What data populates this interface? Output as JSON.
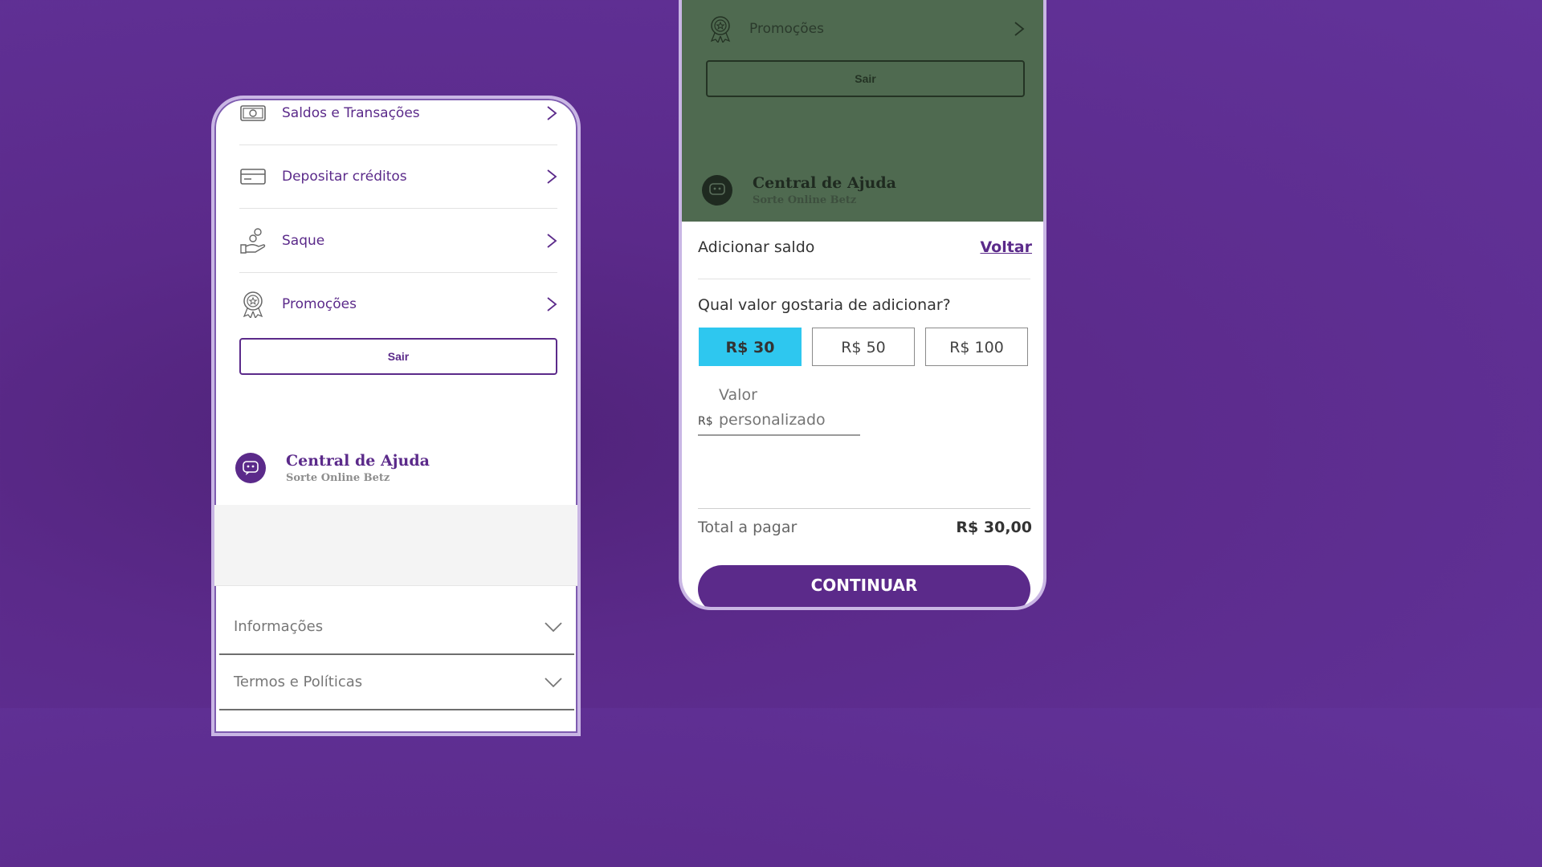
{
  "left_phone": {
    "menu": [
      {
        "label": "Saldos e Transações",
        "icon": "money-icon"
      },
      {
        "label": "Depositar créditos",
        "icon": "credit-card-icon"
      },
      {
        "label": "Saque",
        "icon": "hand-coins-icon"
      },
      {
        "label": "Promoções",
        "icon": "award-icon"
      }
    ],
    "logout_label": "Sair",
    "help": {
      "title": "Central de Ajuda",
      "subtitle": "Sorte Online Betz"
    },
    "accordions": [
      {
        "label": "Informações"
      },
      {
        "label": "Termos e Políticas"
      }
    ]
  },
  "right_phone": {
    "overlay": {
      "menu_label": "Promoções",
      "logout_label": "Sair",
      "help": {
        "title": "Central de Ajuda",
        "subtitle": "Sorte Online Betz"
      }
    },
    "sheet": {
      "title": "Adicionar saldo",
      "back_label": "Voltar",
      "question": "Qual valor gostaria de adicionar?",
      "amounts": [
        "R$ 30",
        "R$ 50",
        "R$ 100"
      ],
      "selected_amount": "R$ 30",
      "custom_prefix": "R$",
      "custom_placeholder": "Valor personalizado",
      "total_label": "Total a pagar",
      "total_value": "R$ 30,00",
      "continue_label": "CONTINUAR"
    }
  },
  "colors": {
    "brand_purple": "#5b2a8a",
    "selected_amount": "#2ec7ef",
    "overlay": "#4f6a50"
  }
}
